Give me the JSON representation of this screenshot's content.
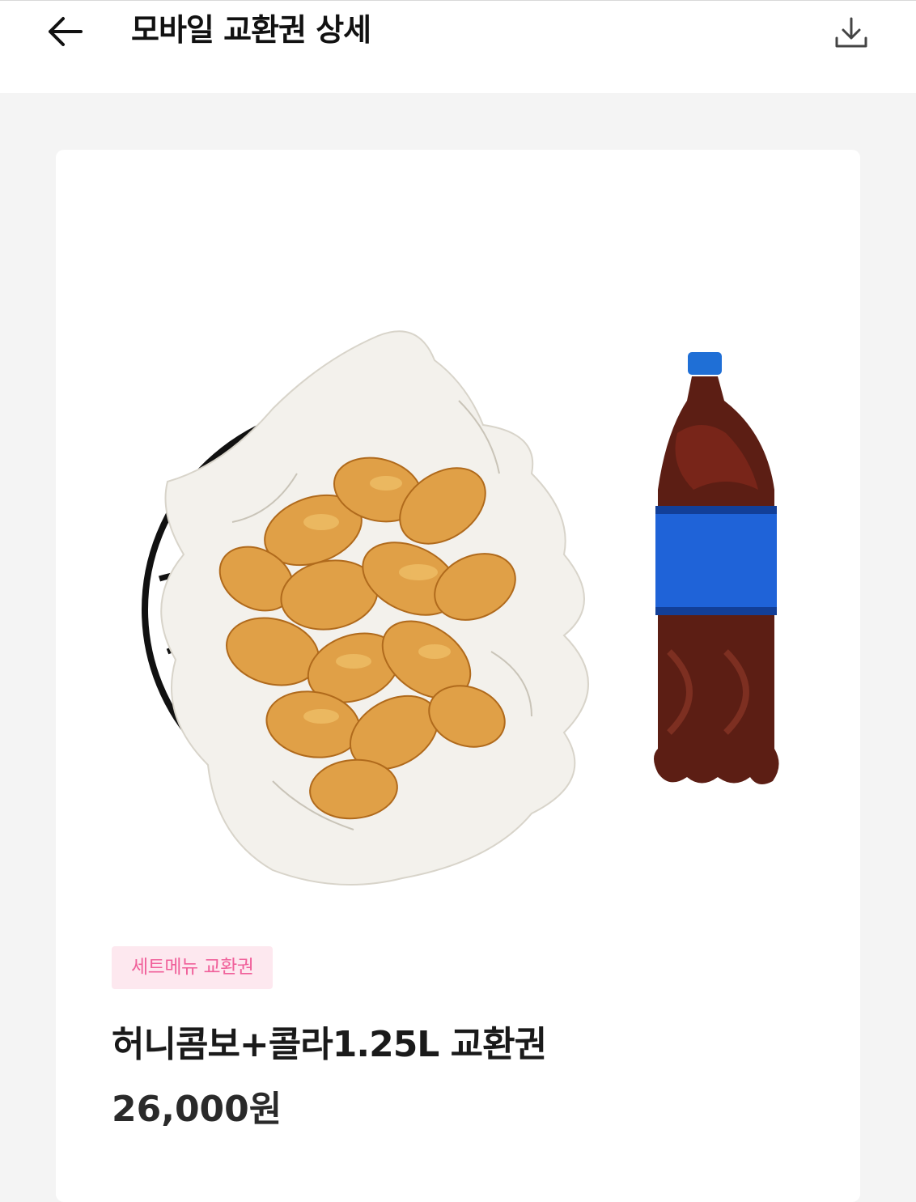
{
  "header": {
    "title": "모바일 교환권 상세",
    "back_icon": "arrow-left-icon",
    "download_icon": "download-icon"
  },
  "product": {
    "category_badge": "세트메뉴 교환권",
    "name": "허니콤보+콜라1.25L 교환권",
    "price": "26,000원",
    "image": "honey-combo-chicken-and-cola-photo"
  },
  "colors": {
    "accent_pink": "#f0609a",
    "badge_bg": "#fde8ef",
    "page_bg": "#f4f4f4"
  }
}
